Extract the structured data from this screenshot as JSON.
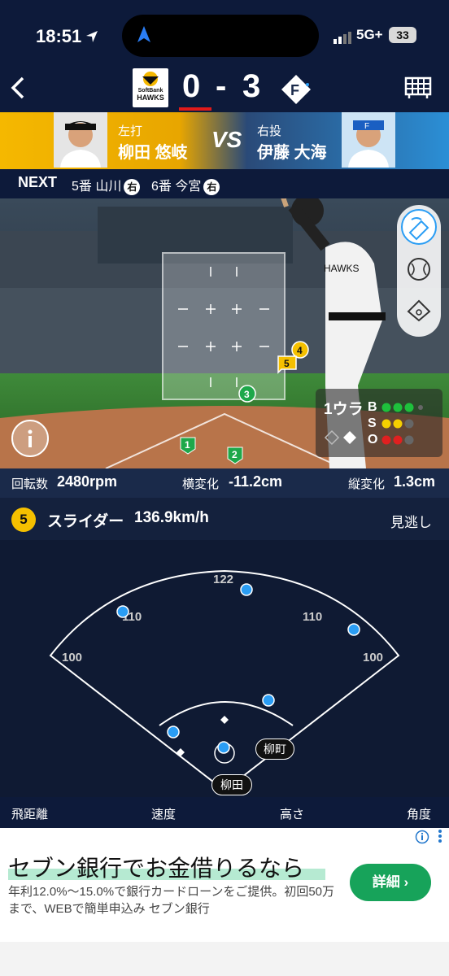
{
  "status": {
    "time": "18:51",
    "network": "5G+",
    "battery": "33"
  },
  "score": {
    "home": "0",
    "dash": "-",
    "away": "3",
    "home_team": "SoftBank",
    "home_team_sub": "HAWKS"
  },
  "matchup": {
    "batter_hand": "左打",
    "batter_name": "柳田 悠岐",
    "vs": "VS",
    "pitcher_hand": "右投",
    "pitcher_name": "伊藤 大海"
  },
  "next": {
    "label": "NEXT",
    "items": [
      {
        "text": "5番 山川",
        "hand": "右"
      },
      {
        "text": "6番 今宮",
        "hand": "右"
      }
    ]
  },
  "count": {
    "outs_label": "1ウラ",
    "b": "B",
    "s": "S",
    "o": "O"
  },
  "pitch_markers": [
    "1",
    "2",
    "3",
    "4",
    "5"
  ],
  "metrics": {
    "spin_label": "回転数",
    "spin_value": "2480rpm",
    "hbreak_label": "横変化",
    "hbreak_value": "-11.2cm",
    "vbreak_label": "縦変化",
    "vbreak_value": "1.3cm"
  },
  "pitch": {
    "number": "5",
    "type": "スライダー",
    "speed": "136.9km/h",
    "result": "見逃し"
  },
  "spray": {
    "distances": {
      "center": "122",
      "lc": "110",
      "rc": "110",
      "left": "100",
      "right": "100"
    },
    "runner_label": "柳町",
    "batter_label": "柳田"
  },
  "stats": {
    "distance": "飛距離",
    "speed": "速度",
    "height": "高さ",
    "angle": "角度"
  },
  "ad": {
    "title": "セブン銀行でお金借りるなら",
    "body": "年利12.0%〜15.0%で銀行カードローンをご提供。初回50万まで、WEBで簡単申込み セブン銀行",
    "button": "詳細 ›"
  },
  "colors": {
    "accent": "#f5c000",
    "ball": "#1ec03c",
    "strike": "#f5d000",
    "out": "#e02020",
    "fielder": "#2a9df4"
  }
}
